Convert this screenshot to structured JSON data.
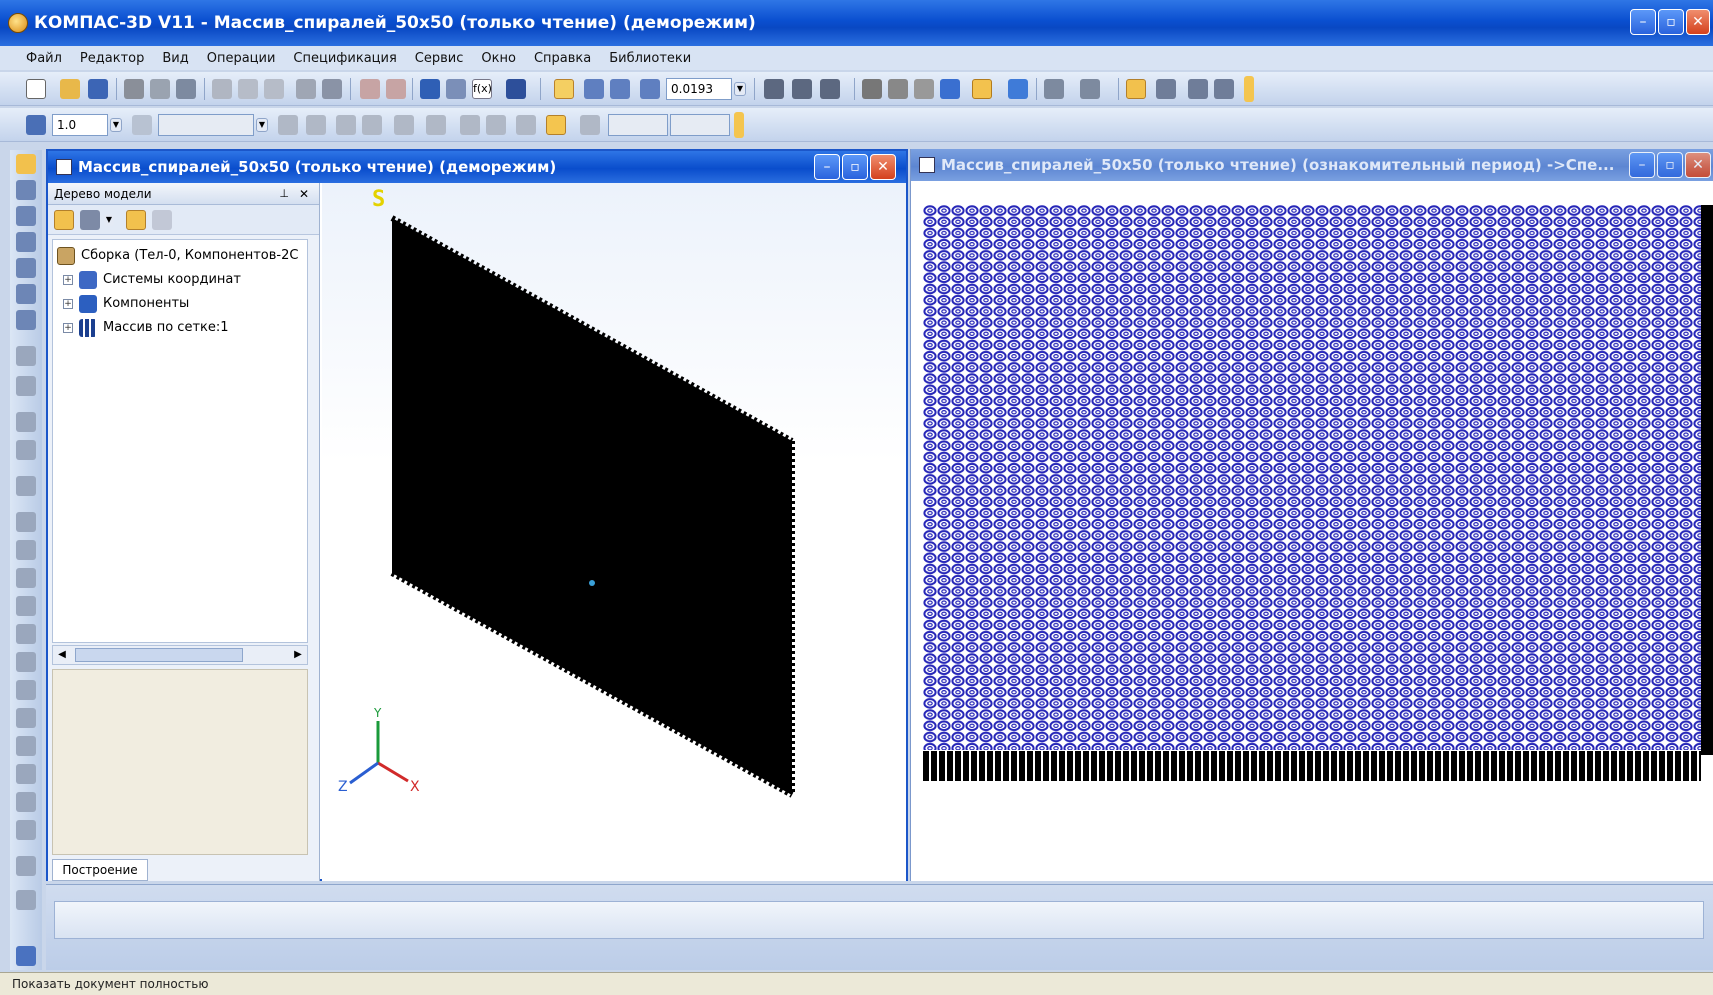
{
  "app": {
    "title": "КОМПАС-3D V11 - Массив_спиралей_50x50 (только чтение) (деморежим)"
  },
  "menu": [
    "Файл",
    "Редактор",
    "Вид",
    "Операции",
    "Спецификация",
    "Сервис",
    "Окно",
    "Справка",
    "Библиотеки"
  ],
  "toolbar": {
    "zoom_value": "0.0193",
    "step_value": "1.0"
  },
  "doc1": {
    "title": "Массив_спиралей_50x50 (только чтение) (деморежим)",
    "tree_header": "Дерево модели",
    "tree_items": [
      "Сборка (Тел-0, Компонентов-2С",
      "Системы координат",
      "Компоненты",
      "Массив по сетке:1"
    ],
    "tab_label": "Построение",
    "viewport_badge": "S",
    "axis_labels": [
      "Y",
      "X",
      "Z"
    ]
  },
  "doc2": {
    "title": "Массив_спиралей_50x50 (только чтение) (ознакомительный период) ->Спе..."
  },
  "status": {
    "text": "Показать документ полностью"
  },
  "colors": {
    "title_blue": "#0a4fd0",
    "spiral_blue": "#2626b8",
    "model_black": "#000000"
  }
}
